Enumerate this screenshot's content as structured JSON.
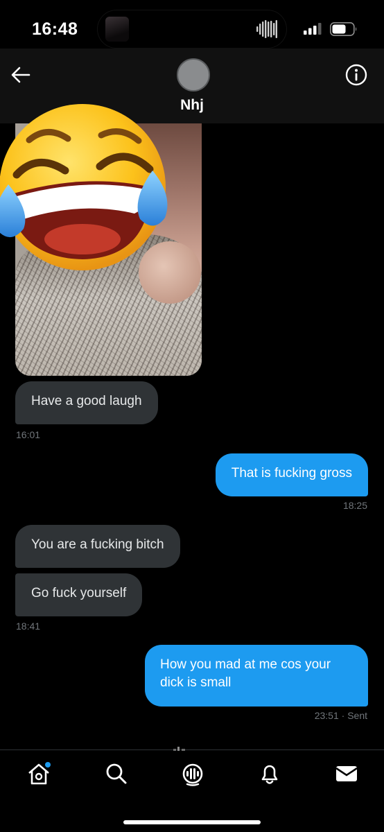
{
  "status_bar": {
    "time": "16:48"
  },
  "header": {
    "contact_name": "Nhj"
  },
  "messages": [
    {
      "direction": "in",
      "text": "Have a good laugh",
      "timestamp": "16:01"
    },
    {
      "direction": "out",
      "text": "That is fucking gross",
      "timestamp": "18:25"
    },
    {
      "direction": "in",
      "text": "You are a fucking bitch",
      "timestamp": ""
    },
    {
      "direction": "in",
      "text": "Go fuck yourself",
      "timestamp": "18:41"
    },
    {
      "direction": "out",
      "text": "How you mad at me cos your dick is small",
      "timestamp": "23:51 · Sent"
    }
  ],
  "icons": {
    "back": "arrow-left-icon",
    "info": "info-icon",
    "overlay": "face-with-tears-of-joy-emoji",
    "nav": [
      "home-icon",
      "search-icon",
      "spaces-icon",
      "notifications-icon",
      "messages-icon"
    ]
  },
  "colors": {
    "background": "#000000",
    "incoming_bubble": "#2f3336",
    "outgoing_bubble": "#1d9bf0",
    "timestamp": "#71767b",
    "notification_dot": "#1d9bf0"
  }
}
